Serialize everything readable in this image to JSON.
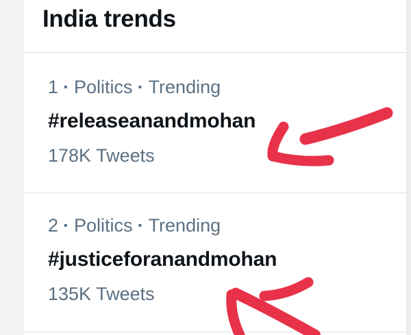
{
  "panel": {
    "title": "India trends"
  },
  "trends": [
    {
      "rank": "1",
      "category": "Politics",
      "status": "Trending",
      "hashtag": "#releaseanandmohan",
      "tweet_count": "178K Tweets"
    },
    {
      "rank": "2",
      "category": "Politics",
      "status": "Trending",
      "hashtag": "#justiceforanandmohan",
      "tweet_count": "135K Tweets"
    }
  ],
  "separator": "·",
  "colors": {
    "annotation_arrow": "#e8324a",
    "secondary_text": "#5b7083",
    "primary_text": "#0f1419"
  }
}
